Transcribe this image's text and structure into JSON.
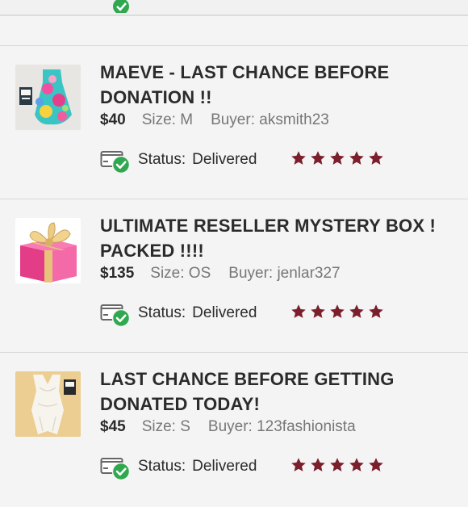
{
  "colors": {
    "star": "#7a1f2b",
    "check": "#2fa84f",
    "price_text": "#2b2b2b",
    "meta_text": "#777777"
  },
  "orders": [
    {
      "title": "MAEVE - LAST CHANCE BEFORE DONATION !!",
      "price": "$40",
      "size": "Size: M",
      "buyer": "Buyer: aksmith23",
      "status_label": "Status:",
      "status_value": "Delivered",
      "rating": 5,
      "thumbnail": "floral-dress-photo"
    },
    {
      "title": "ULTIMATE RESELLER MYSTERY BOX ! PACKED !!!!",
      "price": "$135",
      "size": "Size: OS",
      "buyer": "Buyer: jenlar327",
      "status_label": "Status:",
      "status_value": "Delivered",
      "rating": 5,
      "thumbnail": "pink-gift-box-photo"
    },
    {
      "title": "LAST CHANCE BEFORE GETTING DONATED TODAY!",
      "price": "$45",
      "size": "Size: S",
      "buyer": "Buyer: 123fashionista",
      "status_label": "Status:",
      "status_value": "Delivered",
      "rating": 5,
      "thumbnail": "white-romper-photo"
    }
  ]
}
